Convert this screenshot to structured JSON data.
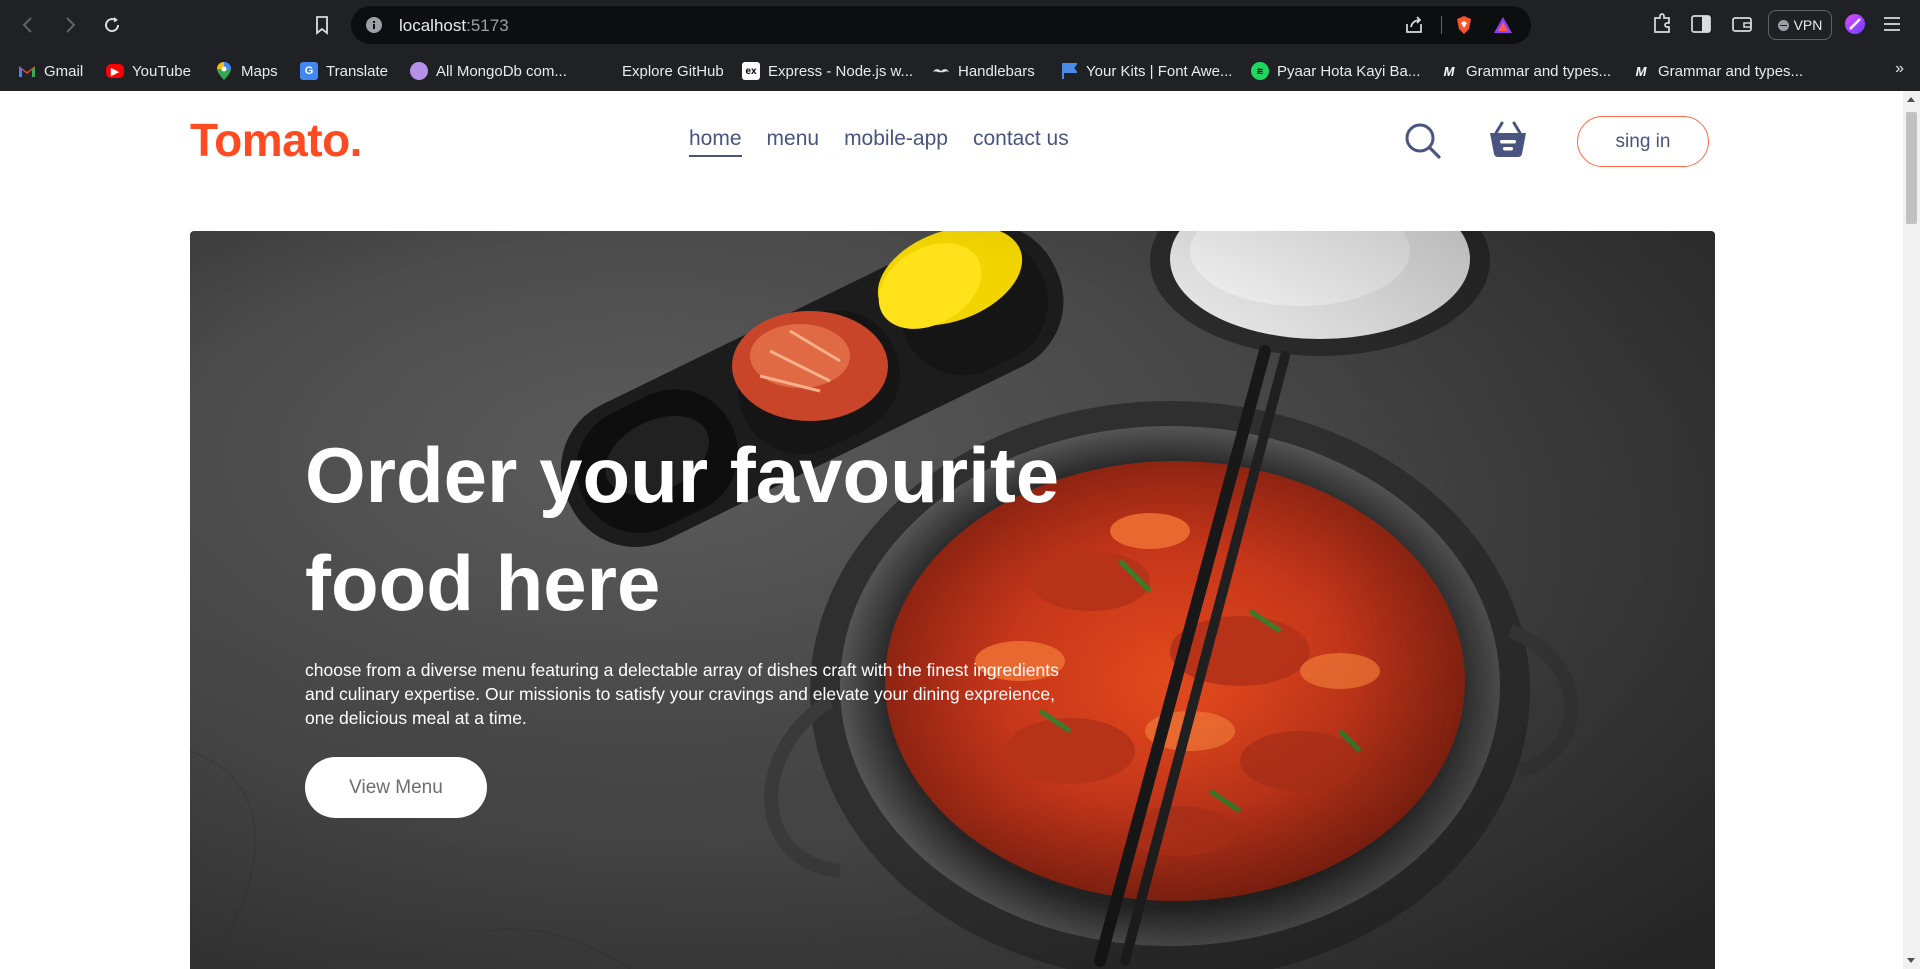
{
  "browser": {
    "url_host": "localhost",
    "url_port": ":5173",
    "vpn_label": "VPN",
    "bookmarks": [
      {
        "label": "Gmail",
        "icon": "gmail-icon"
      },
      {
        "label": "YouTube",
        "icon": "youtube-icon"
      },
      {
        "label": "Maps",
        "icon": "maps-icon"
      },
      {
        "label": "Translate",
        "icon": "translate-icon"
      },
      {
        "label": "All MongoDb com...",
        "icon": "avatar-icon"
      },
      {
        "label": "Explore GitHub",
        "icon": ""
      },
      {
        "label": "Express - Node.js w...",
        "icon": "express-icon"
      },
      {
        "label": "Handlebars",
        "icon": "handlebars-icon"
      },
      {
        "label": "Your Kits | Font Awe...",
        "icon": "fontawesome-icon"
      },
      {
        "label": "Pyaar Hota Kayi Ba...",
        "icon": "spotify-icon"
      },
      {
        "label": "Grammar and types...",
        "icon": "m-icon"
      },
      {
        "label": "Grammar and types...",
        "icon": "m-icon"
      }
    ],
    "more_label": "»"
  },
  "site": {
    "logo": "Tomato.",
    "nav": [
      "home",
      "menu",
      "mobile-app",
      "contact us"
    ],
    "active_nav": "home",
    "signin_label": "sing in"
  },
  "hero": {
    "title": "Order your favourite food here",
    "description": "choose from a diverse menu featuring a delectable array of dishes craft with the finest ingredients and culinary expertise. Our missionis to satisfy your cravings and elevate your dining expreience, one delicious meal at a time.",
    "button_label": "View Menu"
  },
  "colors": {
    "brand": "#ff4a22",
    "nav_text": "#49557e",
    "chrome_bg": "#202124"
  }
}
